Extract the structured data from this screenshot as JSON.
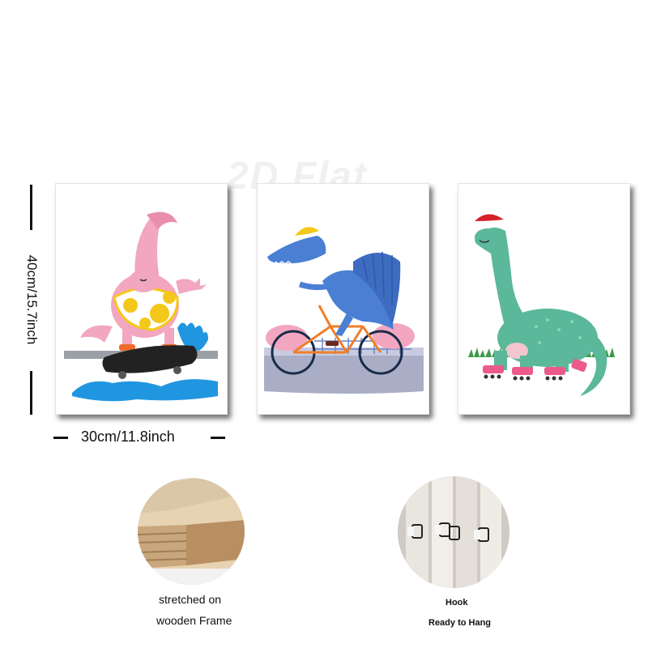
{
  "watermark": "2D Flat",
  "dimensions": {
    "height_label": "40cm/15.7inch",
    "width_label": "30cm/11.8inch"
  },
  "panels": [
    {
      "subject": "pink dinosaur on skateboard"
    },
    {
      "subject": "blue spinosaurus on bicycle"
    },
    {
      "subject": "green long-neck dinosaur on roller skates"
    }
  ],
  "features": {
    "frame": {
      "line1": "stretched on",
      "line2": "wooden Frame"
    },
    "hook": {
      "line1": "Hook",
      "line2": "Ready to Hang"
    }
  },
  "colors": {
    "pink_dino": "#f2a6c0",
    "blue_dino": "#4a7fd4",
    "green_dino": "#5bb89a",
    "water": "#2196e0",
    "bike": "#f07f2a"
  }
}
